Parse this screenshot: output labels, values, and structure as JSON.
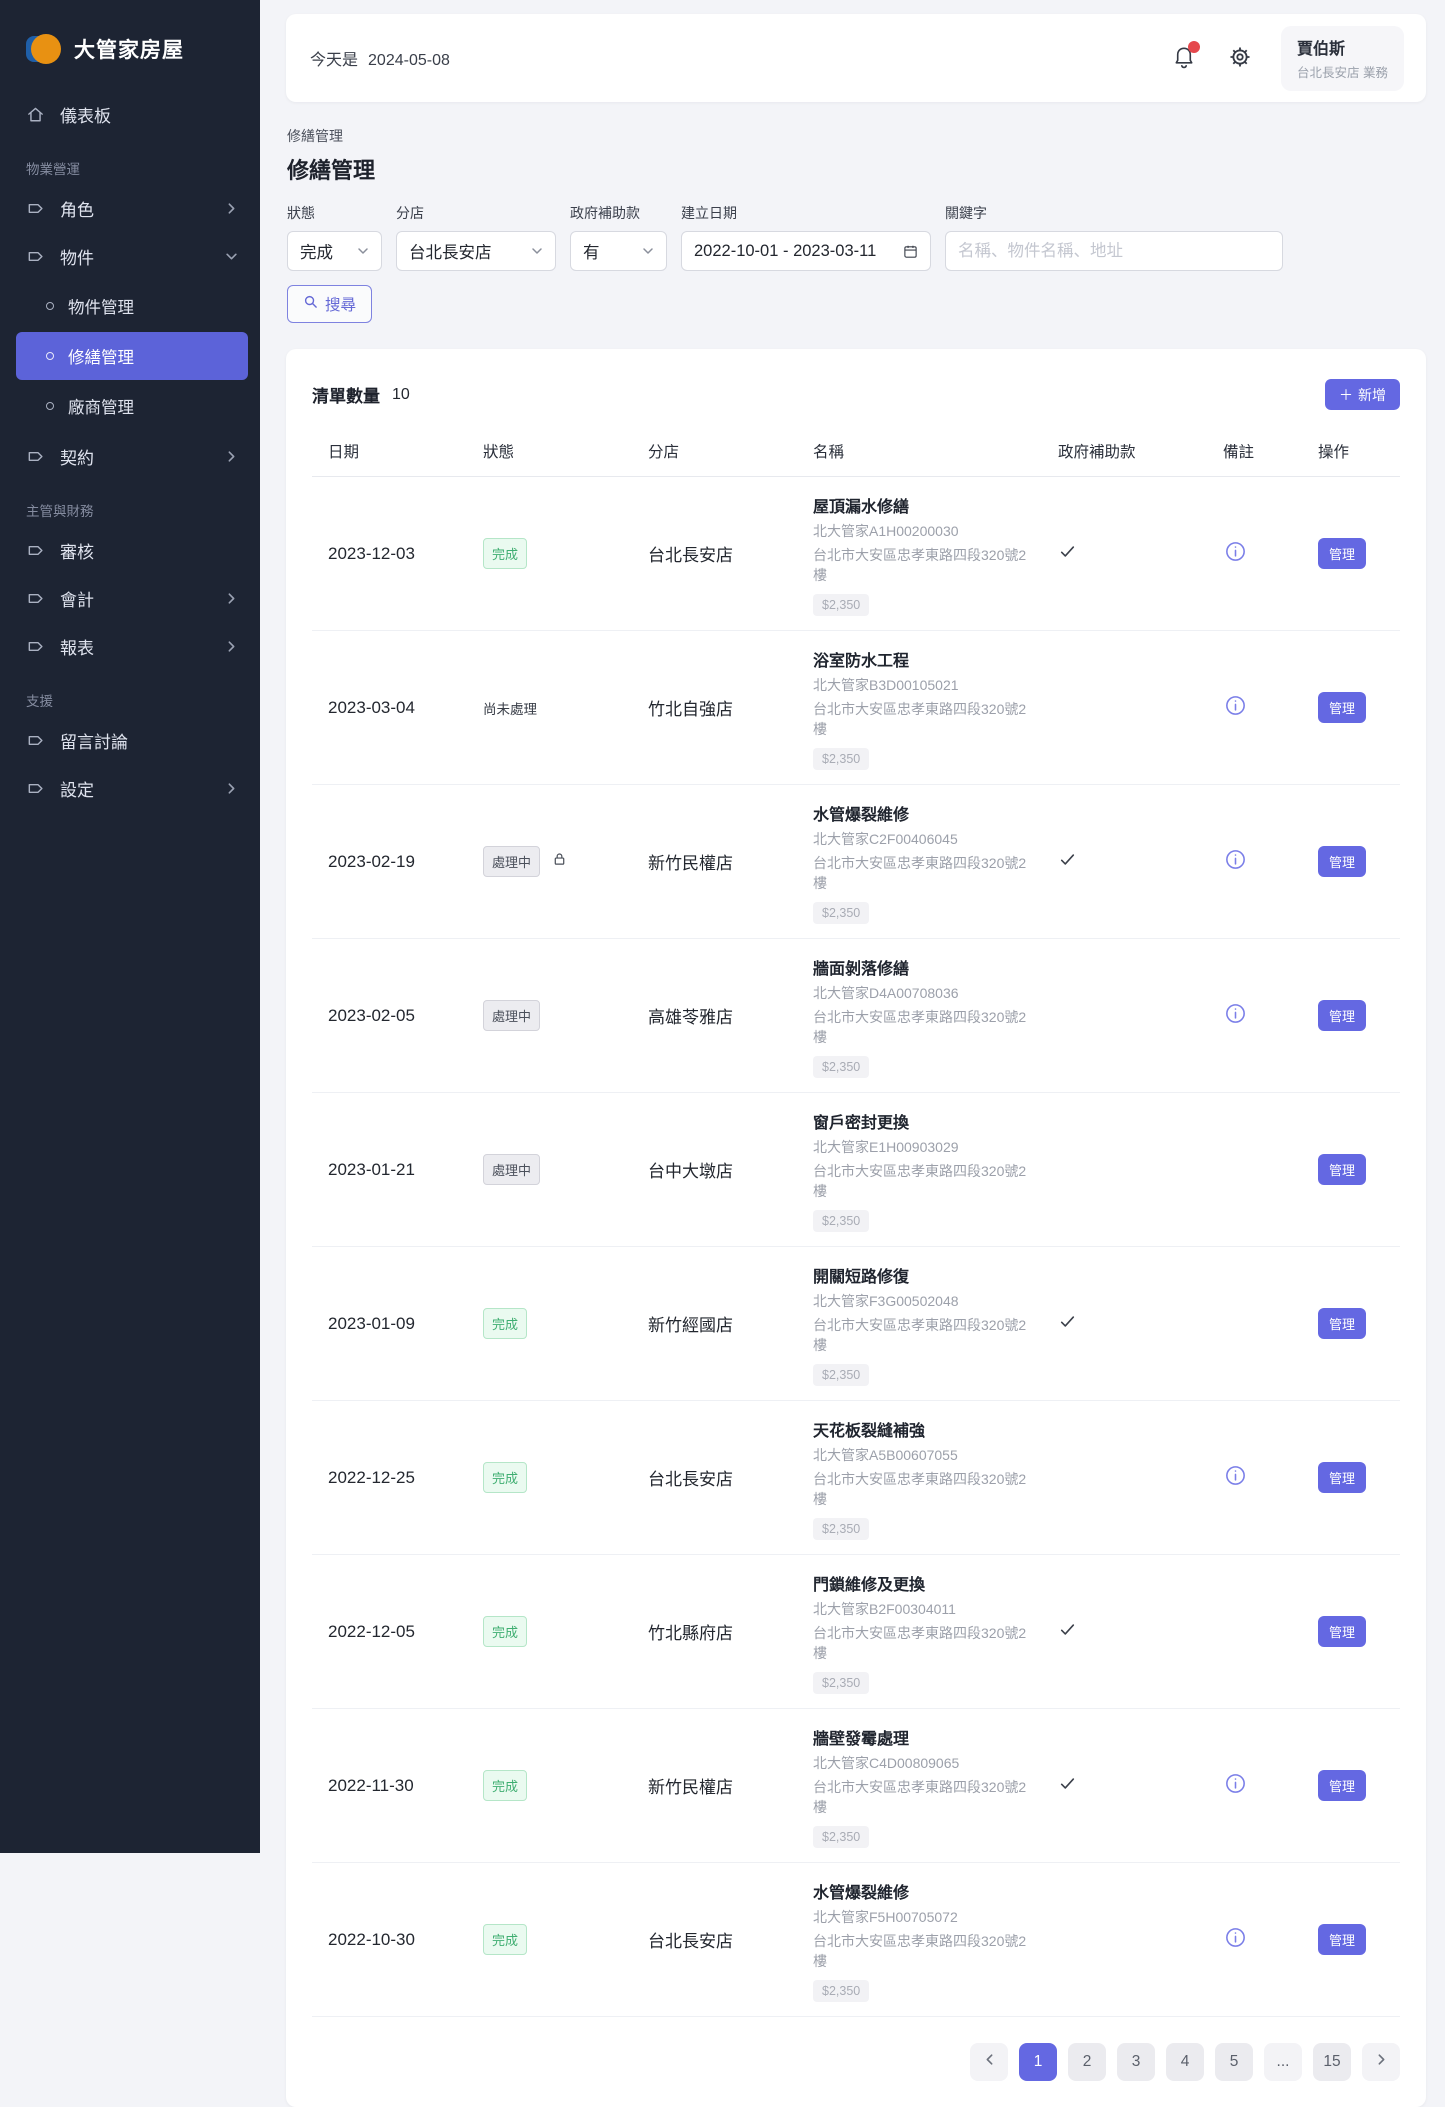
{
  "app": {
    "name": "大管家房屋"
  },
  "colors": {
    "accent": "#6468e2",
    "sidebar_bg": "#1d2433",
    "sidebar_active_bg": "#5c63d9",
    "page_bg": "#f3f4f8",
    "success": "#3fae71",
    "success_bg": "#eafaf0",
    "notification_dot": "#e5484d"
  },
  "sidebar": {
    "items": [
      {
        "type": "item",
        "label": "儀表板",
        "icon": "home",
        "chevron": "none"
      },
      {
        "type": "section",
        "label": "物業營運"
      },
      {
        "type": "item",
        "label": "角色",
        "icon": "tag",
        "chevron": "right"
      },
      {
        "type": "item",
        "label": "物件",
        "icon": "tag",
        "chevron": "down"
      },
      {
        "type": "subitem",
        "label": "物件管理",
        "active": false
      },
      {
        "type": "subitem",
        "label": "修繕管理",
        "active": true
      },
      {
        "type": "subitem",
        "label": "廠商管理",
        "active": false
      },
      {
        "type": "item",
        "label": "契約",
        "icon": "tag",
        "chevron": "right"
      },
      {
        "type": "section",
        "label": "主管與財務"
      },
      {
        "type": "item",
        "label": "審核",
        "icon": "tag",
        "chevron": "none"
      },
      {
        "type": "item",
        "label": "會計",
        "icon": "tag",
        "chevron": "right"
      },
      {
        "type": "item",
        "label": "報表",
        "icon": "tag",
        "chevron": "right"
      },
      {
        "type": "section",
        "label": "支援"
      },
      {
        "type": "item",
        "label": "留言討論",
        "icon": "tag",
        "chevron": "none"
      },
      {
        "type": "item",
        "label": "設定",
        "icon": "tag",
        "chevron": "right"
      }
    ]
  },
  "header": {
    "today_label": "今天是",
    "date": "2024-05-08",
    "icons": [
      "bell-with-badge",
      "gear"
    ],
    "user": {
      "name": "賈伯斯",
      "meta": "台北長安店 業務"
    }
  },
  "page": {
    "breadcrumb": "修繕管理",
    "title": "修繕管理"
  },
  "filters": {
    "status": {
      "label": "狀態",
      "value": "完成"
    },
    "branch": {
      "label": "分店",
      "value": "台北長安店"
    },
    "subsidy": {
      "label": "政府補助款",
      "value": "有"
    },
    "date_range": {
      "label": "建立日期",
      "value": "2022-10-01 - 2023-03-11",
      "icon": "calendar"
    },
    "keyword": {
      "label": "關鍵字",
      "placeholder": "名稱、物件名稱、地址",
      "value": ""
    },
    "search_button": {
      "icon": "search",
      "label": "搜尋"
    }
  },
  "table": {
    "count_label": "清單數量",
    "count": "10",
    "add_button": {
      "icon": "plus",
      "label": "新增"
    },
    "columns": [
      "日期",
      "狀態",
      "分店",
      "名稱",
      "政府補助款",
      "備註",
      "操作"
    ],
    "manage_label": "管理",
    "rows": [
      {
        "date": "2023-12-03",
        "status": "完成",
        "status_style": "done",
        "locked": false,
        "branch": "台北長安店",
        "name": "屋頂漏水修繕",
        "code": "北大管家A1H00200030",
        "address": "台北市大安區忠孝東路四段320號2樓",
        "price": "$2,350",
        "subsidy": true,
        "note": true
      },
      {
        "date": "2023-03-04",
        "status": "尚未處理",
        "status_style": "plain",
        "locked": false,
        "branch": "竹北自強店",
        "name": "浴室防水工程",
        "code": "北大管家B3D00105021",
        "address": "台北市大安區忠孝東路四段320號2樓",
        "price": "$2,350",
        "subsidy": false,
        "note": true
      },
      {
        "date": "2023-02-19",
        "status": "處理中",
        "status_style": "processing",
        "locked": true,
        "branch": "新竹民權店",
        "name": "水管爆裂維修",
        "code": "北大管家C2F00406045",
        "address": "台北市大安區忠孝東路四段320號2樓",
        "price": "$2,350",
        "subsidy": true,
        "note": true
      },
      {
        "date": "2023-02-05",
        "status": "處理中",
        "status_style": "processing",
        "locked": false,
        "branch": "高雄苓雅店",
        "name": "牆面剝落修繕",
        "code": "北大管家D4A00708036",
        "address": "台北市大安區忠孝東路四段320號2樓",
        "price": "$2,350",
        "subsidy": false,
        "note": true
      },
      {
        "date": "2023-01-21",
        "status": "處理中",
        "status_style": "processing",
        "locked": false,
        "branch": "台中大墩店",
        "name": "窗戶密封更換",
        "code": "北大管家E1H00903029",
        "address": "台北市大安區忠孝東路四段320號2樓",
        "price": "$2,350",
        "subsidy": false,
        "note": false
      },
      {
        "date": "2023-01-09",
        "status": "完成",
        "status_style": "done",
        "locked": false,
        "branch": "新竹經國店",
        "name": "開關短路修復",
        "code": "北大管家F3G00502048",
        "address": "台北市大安區忠孝東路四段320號2樓",
        "price": "$2,350",
        "subsidy": true,
        "note": false
      },
      {
        "date": "2022-12-25",
        "status": "完成",
        "status_style": "done",
        "locked": false,
        "branch": "台北長安店",
        "name": "天花板裂縫補強",
        "code": "北大管家A5B00607055",
        "address": "台北市大安區忠孝東路四段320號2樓",
        "price": "$2,350",
        "subsidy": false,
        "note": true
      },
      {
        "date": "2022-12-05",
        "status": "完成",
        "status_style": "done",
        "locked": false,
        "branch": "竹北縣府店",
        "name": "門鎖維修及更換",
        "code": "北大管家B2F00304011",
        "address": "台北市大安區忠孝東路四段320號2樓",
        "price": "$2,350",
        "subsidy": true,
        "note": false
      },
      {
        "date": "2022-11-30",
        "status": "完成",
        "status_style": "done",
        "locked": false,
        "branch": "新竹民權店",
        "name": "牆壁發霉處理",
        "code": "北大管家C4D00809065",
        "address": "台北市大安區忠孝東路四段320號2樓",
        "price": "$2,350",
        "subsidy": true,
        "note": true
      },
      {
        "date": "2022-10-30",
        "status": "完成",
        "status_style": "done",
        "locked": false,
        "branch": "台北長安店",
        "name": "水管爆裂維修",
        "code": "北大管家F5H00705072",
        "address": "台北市大安區忠孝東路四段320號2樓",
        "price": "$2,350",
        "subsidy": false,
        "note": true
      }
    ]
  },
  "pagination": {
    "pages": [
      "1",
      "2",
      "3",
      "4",
      "5",
      "...",
      "15"
    ],
    "active": "1"
  }
}
